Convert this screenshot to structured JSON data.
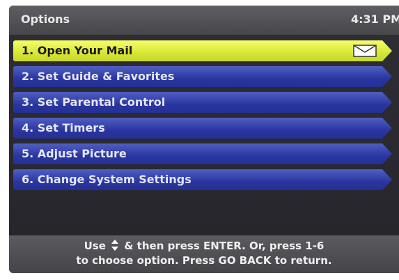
{
  "header": {
    "title": "Options",
    "time": "4:31 PM"
  },
  "menu": {
    "items": [
      {
        "label": "1.  Open Your Mail",
        "selected": true,
        "icon": "mail-icon"
      },
      {
        "label": "2.  Set Guide & Favorites",
        "selected": false
      },
      {
        "label": "3.  Set Parental Control",
        "selected": false
      },
      {
        "label": "4.  Set Timers",
        "selected": false
      },
      {
        "label": "5.  Adjust Picture",
        "selected": false
      },
      {
        "label": "6.  Change System Settings",
        "selected": false
      }
    ]
  },
  "footer": {
    "line1_prefix": "Use",
    "line1_suffix": "& then press ENTER.  Or, press 1-6",
    "line2": "to choose option.  Press GO BACK to return.",
    "icon": "up-down-arrows-icon"
  },
  "colors": {
    "selected_item": "#e6f04a",
    "menu_item": "#2f3ba6",
    "background": "#2a2a30"
  }
}
